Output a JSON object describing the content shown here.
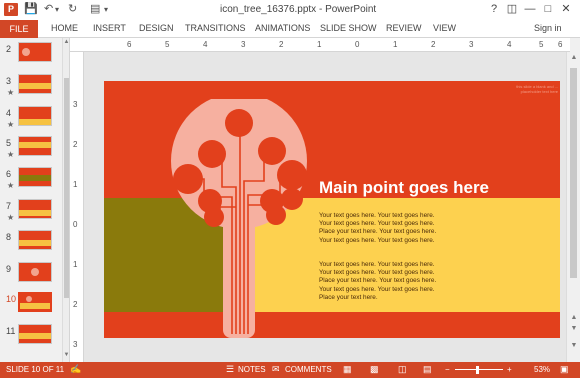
{
  "window": {
    "title": "icon_tree_16376.pptx - PowerPoint",
    "controls": [
      "?",
      "restore-icon",
      "minimize-icon",
      "maximize-icon",
      "close-icon"
    ]
  },
  "quick_access": [
    "save-icon",
    "undo-icon",
    "redo-icon",
    "start-from-beginning-icon",
    "customize-icon"
  ],
  "ribbon": {
    "file_label": "FILE",
    "tabs": [
      "HOME",
      "INSERT",
      "DESIGN",
      "TRANSITIONS",
      "ANIMATIONS",
      "SLIDE SHOW",
      "REVIEW",
      "VIEW"
    ],
    "sign_in": "Sign in"
  },
  "ruler": {
    "horizontal": [
      "6",
      "5",
      "4",
      "3",
      "2",
      "1",
      "0",
      "1",
      "2",
      "3",
      "4",
      "5",
      "6"
    ],
    "vertical": [
      "3",
      "2",
      "1",
      "0",
      "1",
      "2",
      "3"
    ]
  },
  "thumbnails": [
    {
      "number": "2",
      "star": ""
    },
    {
      "number": "3",
      "star": "★"
    },
    {
      "number": "4",
      "star": "★"
    },
    {
      "number": "5",
      "star": "★"
    },
    {
      "number": "6",
      "star": "★"
    },
    {
      "number": "7",
      "star": "★"
    },
    {
      "number": "8",
      "star": ""
    },
    {
      "number": "9",
      "star": ""
    },
    {
      "number": "10",
      "star": ""
    },
    {
      "number": "11",
      "star": ""
    }
  ],
  "slide": {
    "heading": "Main point goes here",
    "corner_note": "this slide a blank and ... placeholder text here",
    "paragraph_1": "Your text goes here. Your text goes here. Your text goes here. Your text goes here. Place your text here. Your text goes here. Your text goes here. Your text goes here.",
    "paragraph_2": "Your text goes here. Your text goes here. Your text goes here. Your text goes here. Place your text here. Your text goes here. Your text goes here. Your text goes here. Place your text here.",
    "colors": {
      "background": "#e2401c",
      "band_yellow": "#fdd14f",
      "band_olive": "#8a7a0c",
      "tree_light": "#f6b0a0",
      "tree_dark": "#e2401c"
    }
  },
  "status": {
    "slide_info": "SLIDE 10 OF 11",
    "notes": "NOTES",
    "comments": "COMMENTS",
    "zoom": "53%",
    "zoom_minus": "−",
    "zoom_plus": "+"
  }
}
